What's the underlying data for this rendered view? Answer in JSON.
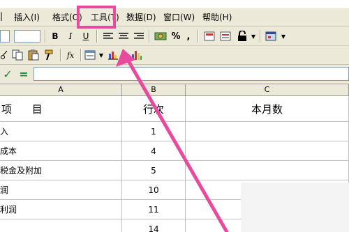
{
  "menubar": {
    "items": [
      {
        "label": "插入(I)"
      },
      {
        "label": "格式(O)"
      },
      {
        "label": "工具(T)"
      },
      {
        "label": "数据(D)"
      },
      {
        "label": "窗口(W)"
      },
      {
        "label": "帮助(H)"
      }
    ]
  },
  "toolbar": {
    "bold": "B",
    "italic": "I",
    "underline": "U",
    "percent": "%",
    "comma": ",",
    "fx": "fx"
  },
  "formula_bar": {
    "check": "✓",
    "equals": "="
  },
  "grid": {
    "columns": [
      "A",
      "B",
      "C"
    ],
    "header_row": [
      "项      目",
      "行次",
      "本月数"
    ],
    "rows": [
      [
        "入",
        "1",
        ""
      ],
      [
        "成本",
        "4",
        ""
      ],
      [
        "税金及附加",
        "5",
        ""
      ],
      [
        "润",
        "10",
        ""
      ],
      [
        "利润",
        "11",
        ""
      ],
      [
        "",
        "14",
        ""
      ]
    ]
  },
  "colors": {
    "highlight": "#e84a9e",
    "toolbar_bg": "#ece9d8"
  }
}
